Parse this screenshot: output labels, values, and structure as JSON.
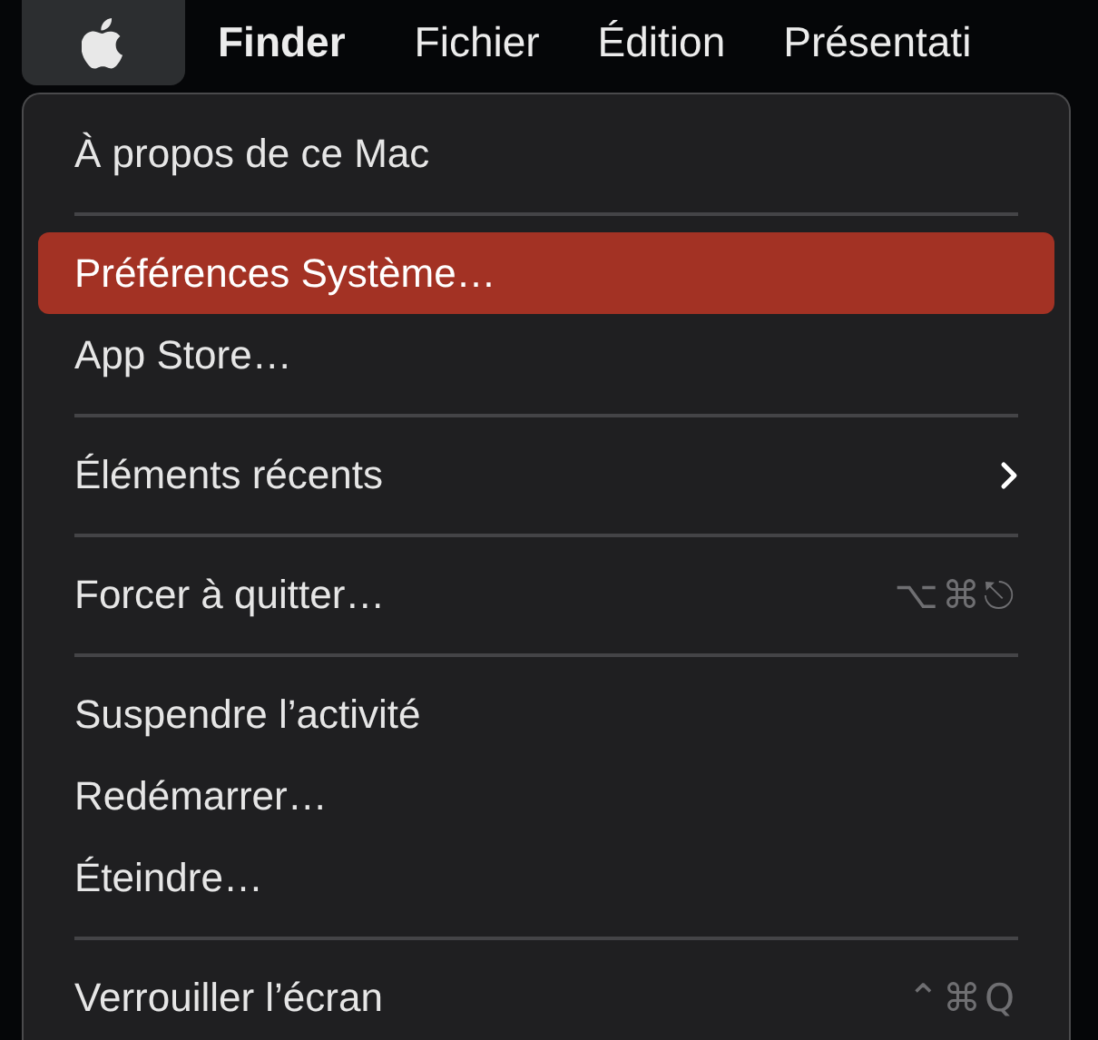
{
  "menu_bar": [
    {
      "kind": "apple",
      "selected": true
    },
    {
      "kind": "app",
      "label": "Finder",
      "selected": false
    },
    {
      "kind": "menu",
      "label": "Fichier",
      "selected": false
    },
    {
      "kind": "menu",
      "label": "Édition",
      "selected": false
    },
    {
      "kind": "menu",
      "label": "Présentati",
      "selected": false
    }
  ],
  "menu": [
    {
      "kind": "item",
      "label": "À propos de ce Mac",
      "selected": false
    },
    {
      "kind": "separator"
    },
    {
      "kind": "item",
      "label": "Préférences Système…",
      "selected": true
    },
    {
      "kind": "item",
      "label": "App Store…",
      "selected": false
    },
    {
      "kind": "separator"
    },
    {
      "kind": "item",
      "label": "Éléments récents",
      "selected": false,
      "submenu": true
    },
    {
      "kind": "separator"
    },
    {
      "kind": "item",
      "label": "Forcer à quitter…",
      "selected": false,
      "shortcut": "⌥⌘⎋"
    },
    {
      "kind": "separator"
    },
    {
      "kind": "item",
      "label": "Suspendre l’activité",
      "selected": false
    },
    {
      "kind": "item",
      "label": "Redémarrer…",
      "selected": false
    },
    {
      "kind": "item",
      "label": "Éteindre…",
      "selected": false
    },
    {
      "kind": "separator"
    },
    {
      "kind": "item",
      "label": "Verrouiller l’écran",
      "selected": false,
      "shortcut": "⌃⌘Q"
    }
  ]
}
